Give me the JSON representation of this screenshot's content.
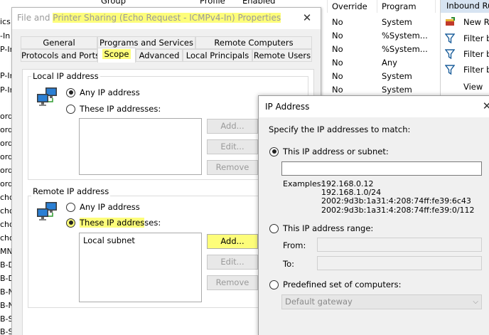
{
  "background": {
    "column_headers": [
      "Group",
      "Profile",
      "Enabled",
      "Override",
      "Program"
    ],
    "left_fragments": [
      "ics",
      "-In",
      "P-In",
      "P-In",
      "P-In",
      "ord",
      "ord",
      "ord",
      "ord",
      "ord",
      "ord",
      "cho",
      "cho",
      "cho",
      "cho",
      "MN",
      "B-D",
      "B-D",
      "B-N",
      "B-N",
      "B-S",
      "B-S"
    ],
    "rows": [
      {
        "override": "No",
        "program": "System"
      },
      {
        "override": "No",
        "program": "%System..."
      },
      {
        "override": "No",
        "program": "%System..."
      },
      {
        "override": "No",
        "program": "Any"
      },
      {
        "override": "No",
        "program": "System"
      },
      {
        "override": "No",
        "program": "System"
      }
    ],
    "actions": {
      "title": "Inbound Ru",
      "items": [
        {
          "label": "New R",
          "icon": "new-rule-icon"
        },
        {
          "label": "Filter b",
          "icon": "filter-icon"
        },
        {
          "label": "Filter b",
          "icon": "filter-icon"
        },
        {
          "label": "Filter b",
          "icon": "filter-icon"
        },
        {
          "label": "View",
          "icon": ""
        }
      ]
    }
  },
  "properties_dialog": {
    "title_prefix": "File and ",
    "title_highlight": "Printer Sharing (Echo Request - ICMPv4-In) Properties",
    "close_glyph": "✕",
    "tabs_row1": [
      "General",
      "Programs and Services",
      "Remote Computers"
    ],
    "tabs_row2": [
      "Protocols and Ports",
      "Scope",
      "Advanced",
      "Local Principals",
      "Remote Users"
    ],
    "active_tab": "Scope",
    "local": {
      "label": "Local IP address",
      "any": "Any IP address",
      "these": "These IP addresses:",
      "selected": "any",
      "list_items": [],
      "buttons": {
        "add": "Add...",
        "edit": "Edit...",
        "remove": "Remove"
      }
    },
    "remote": {
      "label": "Remote IP address",
      "any": "Any IP address",
      "these_highlight": "These IP addres",
      "these_rest": "ses:",
      "selected": "these",
      "list_items": [
        "Local subnet"
      ],
      "buttons": {
        "add": "Add...",
        "edit": "Edit...",
        "remove": "Remove"
      }
    },
    "colors": {
      "highlight": "#fdfd7a"
    }
  },
  "ip_dialog": {
    "title": "IP Address",
    "close_glyph": "✕",
    "instruction": "Specify the IP addresses to match:",
    "option_subnet": "This IP address or subnet:",
    "subnet_value": "",
    "examples_label": "Examples:",
    "examples": [
      "192.168.0.12",
      "192.168.1.0/24",
      "2002:9d3b:1a31:4:208:74ff:fe39:6c43",
      "2002:9d3b:1a31:4:208:74ff:fe39:0/112"
    ],
    "option_range": "This IP address range:",
    "from_label": "From:",
    "to_label": "To:",
    "option_predefined": "Predefined set of computers:",
    "predefined_value": "Default gateway",
    "selected": "subnet"
  }
}
